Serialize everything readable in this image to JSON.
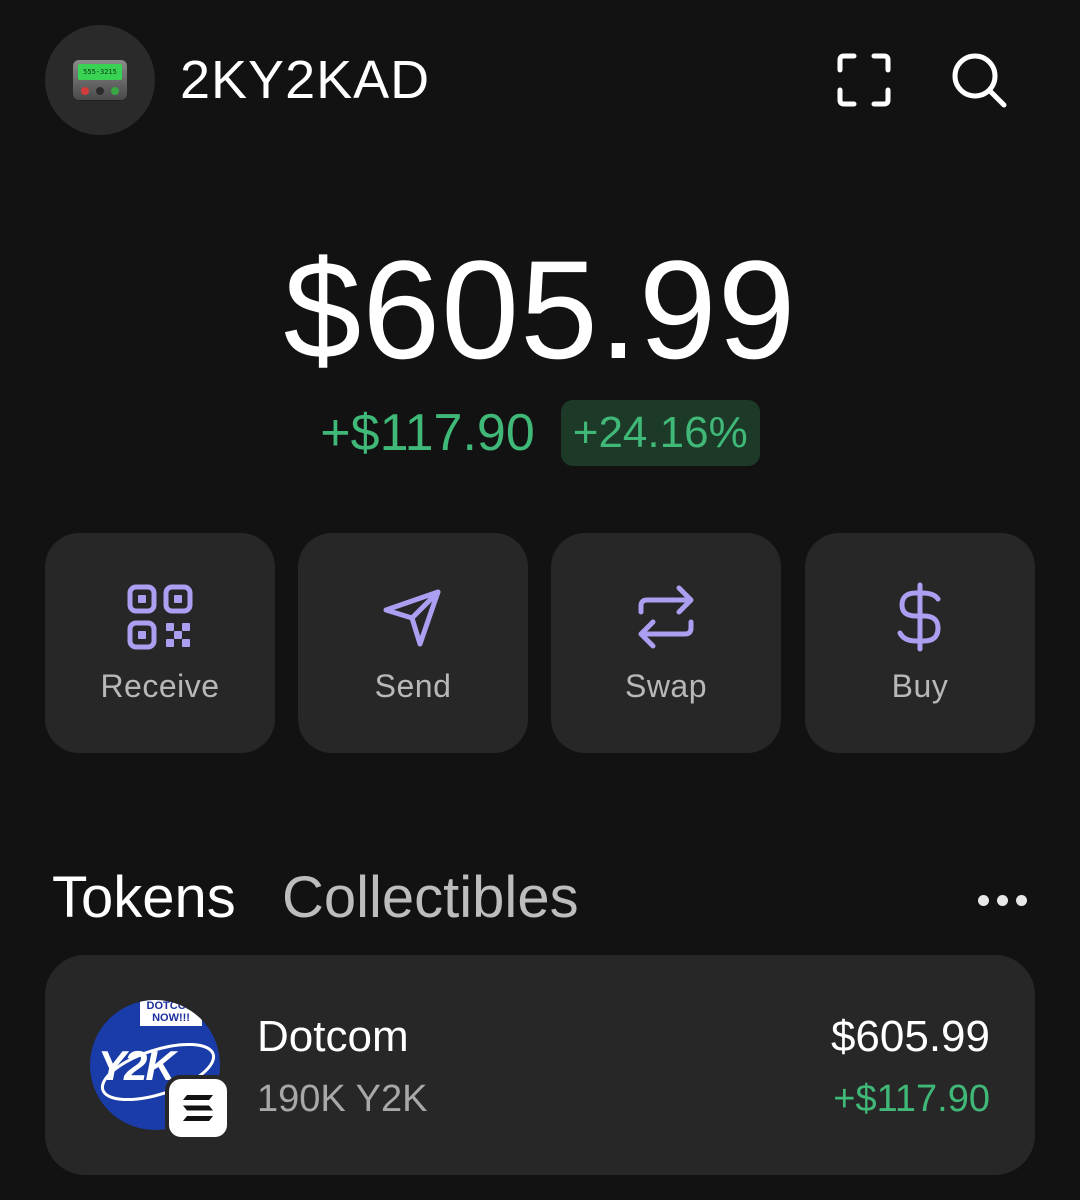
{
  "header": {
    "username": "2KY2KAD",
    "avatar_screen_text": "555-3215",
    "icons": [
      "scan-icon",
      "search-icon"
    ]
  },
  "balance": {
    "total": "$605.99",
    "change_amount": "+$117.90",
    "change_percent": "+24.16%"
  },
  "actions": [
    {
      "label": "Receive",
      "icon": "qr-code-icon"
    },
    {
      "label": "Send",
      "icon": "send-icon"
    },
    {
      "label": "Swap",
      "icon": "swap-icon"
    },
    {
      "label": "Buy",
      "icon": "dollar-icon"
    }
  ],
  "tabs": [
    {
      "label": "Tokens",
      "active": true
    },
    {
      "label": "Collectibles",
      "active": false
    }
  ],
  "tokens": [
    {
      "name": "Dotcom",
      "amount": "190K Y2K",
      "value": "$605.99",
      "change": "+$117.90",
      "logo_banner_text": "DOTCOM NOW!!!",
      "logo_text": "Y2K"
    }
  ],
  "colors": {
    "background": "#121212",
    "card": "#272727",
    "accent": "#ab9ff2",
    "positive": "#3fb878",
    "positive_bg": "#1d3a29"
  }
}
